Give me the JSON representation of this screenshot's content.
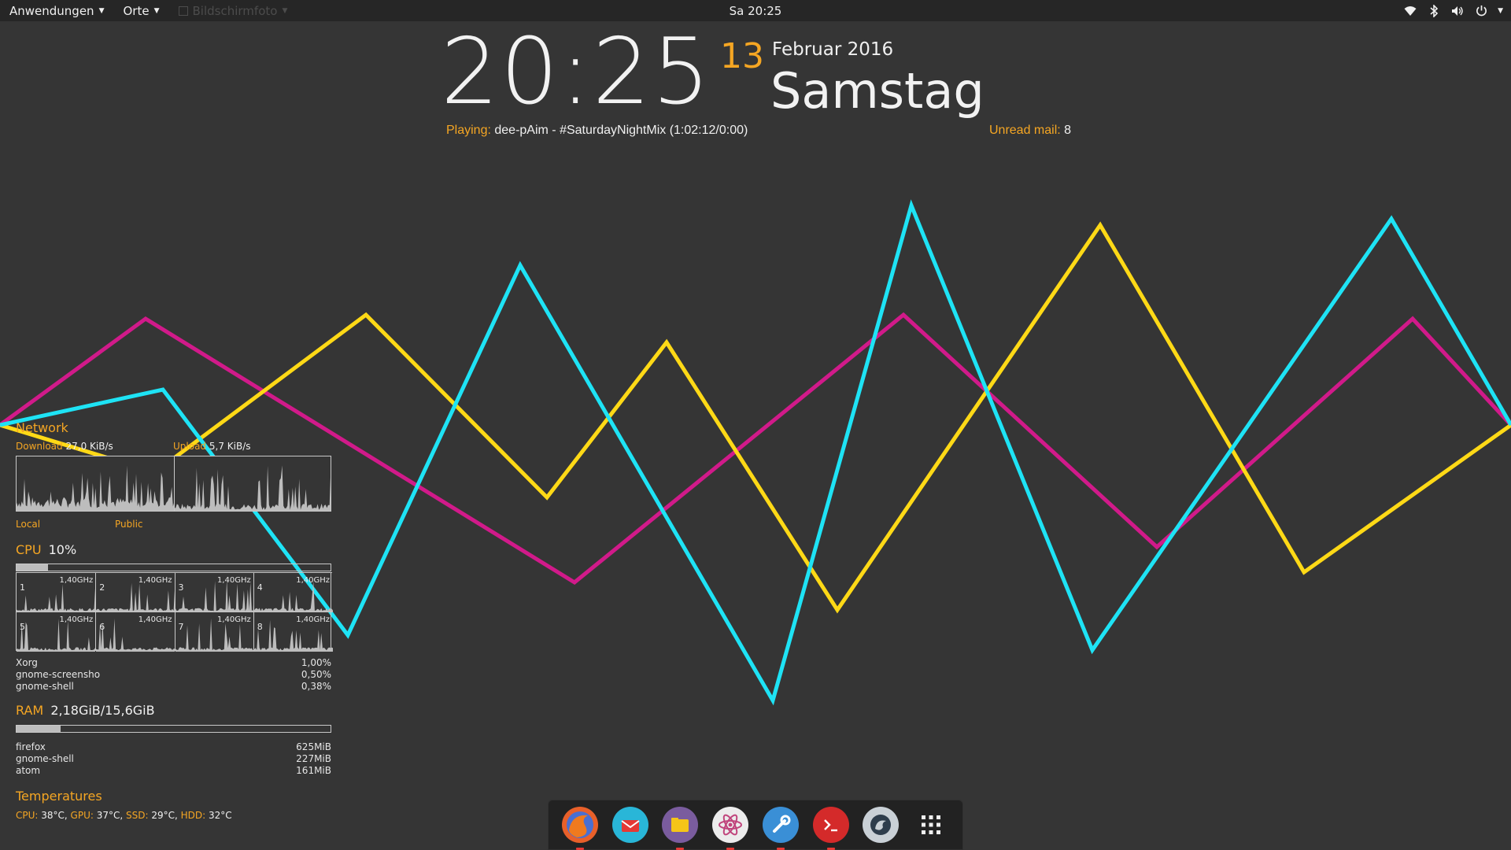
{
  "topbar": {
    "applications": "Anwendungen",
    "places": "Orte",
    "screenshot": "Bildschirmfoto",
    "clock": "Sa 20:25",
    "icons": [
      "wifi-icon",
      "bluetooth-icon",
      "volume-icon",
      "power-icon"
    ]
  },
  "clock": {
    "time": "20:25",
    "day": "13",
    "month_year": "Februar 2016",
    "weekday": "Samstag",
    "playing_label": "Playing:",
    "playing_value": "dee-pAim - #SaturdayNightMix (1:02:12/0:00)",
    "mail_label": "Unread mail:",
    "mail_value": "8"
  },
  "network": {
    "title": "Network",
    "download_label": "Download",
    "download_value": "27,0 KiB/s",
    "upload_label": "Upload",
    "upload_value": "5,7 KiB/s",
    "local_label": "Local",
    "public_label": "Public"
  },
  "cpu": {
    "title": "CPU",
    "value": "10%",
    "usage_fraction": 0.1,
    "cores": [
      {
        "id": "1",
        "freq": "1,40GHz"
      },
      {
        "id": "2",
        "freq": "1,40GHz"
      },
      {
        "id": "3",
        "freq": "1,40GHz"
      },
      {
        "id": "4",
        "freq": "1,40GHz"
      },
      {
        "id": "5",
        "freq": "1,40GHz"
      },
      {
        "id": "6",
        "freq": "1,40GHz"
      },
      {
        "id": "7",
        "freq": "1,40GHz"
      },
      {
        "id": "8",
        "freq": "1,40GHz"
      }
    ],
    "processes": [
      {
        "name": "Xorg",
        "value": "1,00%"
      },
      {
        "name": "gnome-screensho",
        "value": "0,50%"
      },
      {
        "name": "gnome-shell",
        "value": "0,38%"
      }
    ]
  },
  "ram": {
    "title": "RAM",
    "value": "2,18GiB/15,6GiB",
    "usage_fraction": 0.14,
    "processes": [
      {
        "name": "firefox",
        "value": "625MiB"
      },
      {
        "name": "gnome-shell",
        "value": "227MiB"
      },
      {
        "name": "atom",
        "value": "161MiB"
      }
    ]
  },
  "temperatures": {
    "title": "Temperatures",
    "items": [
      {
        "label": "CPU:",
        "value": "38°C"
      },
      {
        "label": "GPU:",
        "value": "37°C"
      },
      {
        "label": "SSD:",
        "value": "29°C"
      },
      {
        "label": "HDD:",
        "value": "32°C"
      }
    ]
  },
  "dock": {
    "apps": [
      "firefox-icon",
      "mail-icon",
      "files-icon",
      "atom-icon",
      "settings-icon",
      "terminal-icon",
      "browser-icon",
      "app-grid-icon"
    ]
  },
  "colors": {
    "accent": "#f5a623",
    "line_magenta": "#d11a8a",
    "line_yellow": "#ffd916",
    "line_cyan": "#1ee3f5",
    "background": "#353535"
  }
}
